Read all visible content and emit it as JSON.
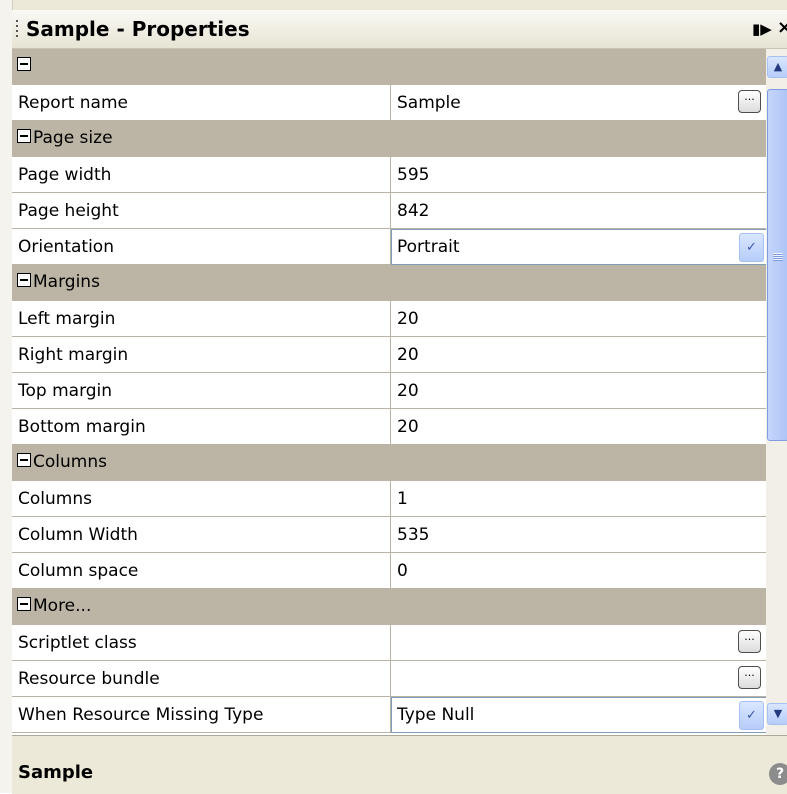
{
  "title": "Sample - Properties",
  "grid": {
    "category_0": {
      "label": ""
    },
    "report_name": {
      "name": "Report name",
      "value": "Sample"
    },
    "page_size": {
      "label": "Page size"
    },
    "page_width": {
      "name": "Page width",
      "value": "595"
    },
    "page_height": {
      "name": "Page height",
      "value": "842"
    },
    "orientation": {
      "name": "Orientation",
      "value": "Portrait"
    },
    "margins": {
      "label": "Margins"
    },
    "left_margin": {
      "name": "Left margin",
      "value": "20"
    },
    "right_margin": {
      "name": "Right margin",
      "value": "20"
    },
    "top_margin": {
      "name": "Top margin",
      "value": "20"
    },
    "bottom_margin": {
      "name": "Bottom margin",
      "value": "20"
    },
    "columns_cat": {
      "label": "Columns"
    },
    "columns": {
      "name": "Columns",
      "value": "1"
    },
    "column_width": {
      "name": "Column Width",
      "value": "535"
    },
    "column_space": {
      "name": "Column space",
      "value": "0"
    },
    "more": {
      "label": "More..."
    },
    "scriptlet_class": {
      "name": "Scriptlet class",
      "value": ""
    },
    "resource_bundle": {
      "name": "Resource bundle",
      "value": ""
    },
    "when_resource_missing": {
      "name": "When Resource Missing Type",
      "value": "Type Null"
    }
  },
  "footer": {
    "selected_name": "Sample"
  },
  "icons": {
    "pin": "pin-icon",
    "close": "close-icon",
    "help": "help-icon",
    "ellipsis": "ellipsis-button",
    "dropdown": "chevron-down-icon"
  },
  "colors": {
    "category_bg": "#bcb5a6",
    "panel_bg": "#ece9d8",
    "grid_line": "#b9b3a5"
  }
}
